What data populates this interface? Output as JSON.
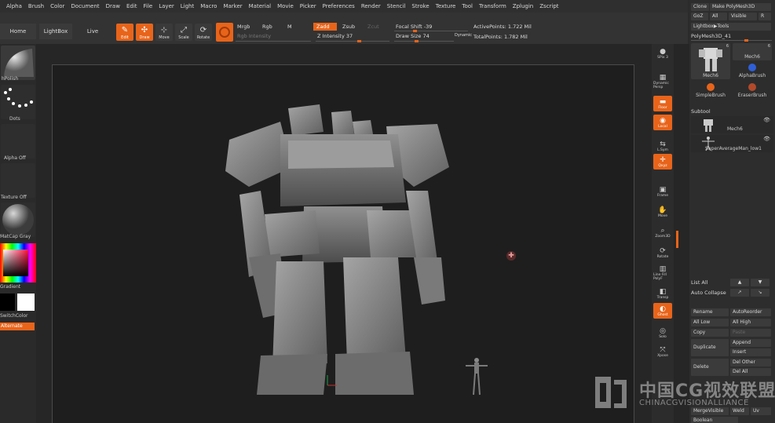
{
  "menu": [
    "Alpha",
    "Brush",
    "Color",
    "Document",
    "Draw",
    "Edit",
    "File",
    "Layer",
    "Light",
    "Macro",
    "Marker",
    "Material",
    "Movie",
    "Picker",
    "Preferences",
    "Render",
    "Stencil",
    "Stroke",
    "Texture",
    "Tool",
    "Transform",
    "Zplugin",
    "Zscript"
  ],
  "toolbar": {
    "home_page": "Home Page",
    "lightbox": "LightBox",
    "live_boolean": "Live Boolean",
    "edit": "Edit",
    "draw": "Draw",
    "move": "Move",
    "scale": "Scale",
    "rotate": "Rotate",
    "mrgb": "Mrgb",
    "rgb": "Rgb",
    "m": "M",
    "rgb_intensity": "Rgb Intensity",
    "zadd": "Zadd",
    "zsub": "Zsub",
    "zcut": "Zcut",
    "z_intensity": "Z Intensity 37",
    "focal_shift": "Focal Shift -39",
    "draw_size": "Draw Size 74",
    "dynamic": "Dynamic",
    "active_points": "ActivePoints: 1.722 Mil",
    "total_points": "TotalPoints: 1.782 Mil"
  },
  "left_panel": {
    "brush": "hPolish",
    "stroke": "Dots",
    "alpha": "Alpha Off",
    "texture": "Texture Off",
    "material": "MatCap Gray",
    "gradient": "Gradient",
    "switch_color": "SwitchColor",
    "alternate": "Alternate"
  },
  "right_shelf": [
    {
      "label": "SPix 3",
      "icon": "sphere-icon"
    },
    {
      "label": "Dynamic Persp",
      "icon": "perspective-icon"
    },
    {
      "label": "Floor",
      "icon": "floor-icon"
    },
    {
      "label": "Local",
      "icon": "local-icon"
    },
    {
      "label": "L.Sym",
      "icon": "symmetry-icon"
    },
    {
      "label": "Qxyz",
      "icon": "axis-icon"
    },
    {
      "label": "Frame",
      "icon": "frame-icon"
    },
    {
      "label": "Move",
      "icon": "hand-icon"
    },
    {
      "label": "Zoom3D",
      "icon": "zoom-icon"
    },
    {
      "label": "Rotate",
      "icon": "rotate-icon"
    },
    {
      "label": "Line Fill PolyF",
      "icon": "polyframe-icon"
    },
    {
      "label": "Transp",
      "icon": "transparency-icon"
    },
    {
      "label": "Ghost",
      "icon": "ghost-icon"
    },
    {
      "label": "Solo",
      "icon": "solo-icon"
    },
    {
      "label": "Xpose",
      "icon": "xpose-icon"
    }
  ],
  "right_panel": {
    "clone": "Clone",
    "make_polymesh": "Make PolyMesh3D",
    "goz": "GoZ",
    "all": "All",
    "visible": "Visible",
    "r": "R",
    "lightbox_tools": "Lightbox▶Tools",
    "current_tool": "PolyMesh3D_41",
    "thumbs": [
      {
        "name": "Mech6",
        "count": "6"
      },
      {
        "name": "Mech6",
        "count": "6"
      },
      {
        "name": "AlphaBrush",
        "count": ""
      },
      {
        "name": "SimpleBrush",
        "count": ""
      },
      {
        "name": "EraserBrush",
        "count": ""
      }
    ],
    "subtool_header": "Subtool",
    "subtools": [
      "Mech6",
      "SuperAverageMan_low1"
    ],
    "list_all": "List All",
    "auto_collapse": "Auto Collapse",
    "rename": "Rename",
    "auto_reorder": "AutoReorder",
    "all_low": "All Low",
    "all_high": "All High",
    "copy": "Copy",
    "paste": "Paste",
    "duplicate": "Duplicate",
    "append": "Append",
    "insert": "Insert",
    "delete": "Delete",
    "del_other": "Del Other",
    "del_all": "Del All",
    "merge_visible": "MergeVisible",
    "weld": "Weld",
    "uv": "Uv",
    "boolean": "Boolean"
  },
  "watermark": {
    "cn": "中国CG视效联盟",
    "en": "CHINACGVISIONALLIANCE"
  },
  "colors": {
    "accent": "#e8641a",
    "panel": "#2d2d2d",
    "viewport": "#1e1e1e",
    "model": "#8a8a8a"
  }
}
